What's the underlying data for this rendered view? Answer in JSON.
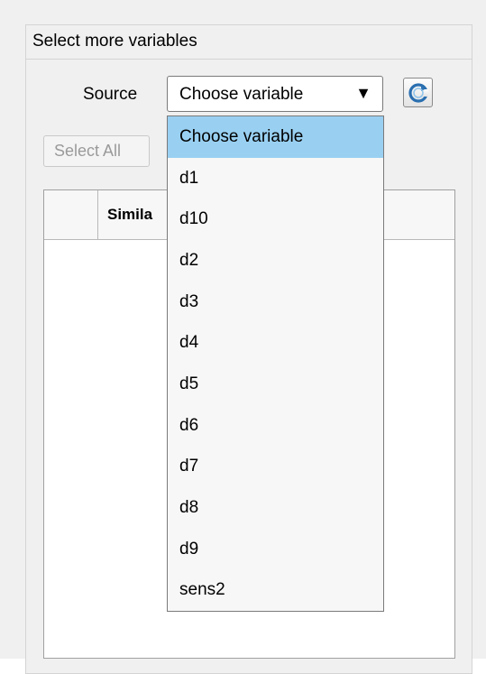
{
  "panel": {
    "title": "Select more variables"
  },
  "source": {
    "label": "Source",
    "selected": "Choose variable",
    "arrow": "▼",
    "refresh_icon": "refresh-icon",
    "options": [
      "Choose variable",
      "d1",
      "d10",
      "d2",
      "d3",
      "d4",
      "d5",
      "d6",
      "d7",
      "d8",
      "d9",
      "sens2"
    ]
  },
  "select_all": {
    "label": "Select All"
  },
  "table": {
    "columns": [
      "",
      "Simila"
    ]
  },
  "colors": {
    "selection": "#99d0f2",
    "panel_bg": "#f0f0f0"
  }
}
